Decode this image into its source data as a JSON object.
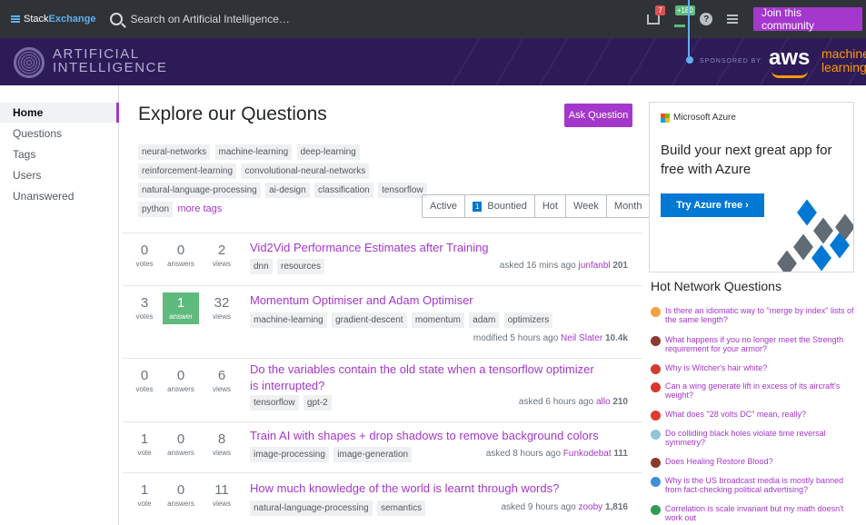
{
  "topbar": {
    "logo_stack": "Stack",
    "logo_exchange": "Exchange",
    "search_placeholder": "Search on Artificial Intelligence…",
    "inbox_count": "7",
    "rep_change": "+180",
    "help_glyph": "?",
    "join_label": "Join this community"
  },
  "banner": {
    "site_line1": "ARTIFICIAL",
    "site_line2": "INTELLIGENCE",
    "sponsored_by": "SPONSORED BY",
    "aws": "aws",
    "ml_line1": "machine",
    "ml_line2": "learning"
  },
  "sidebar": {
    "items": [
      {
        "label": "Home"
      },
      {
        "label": "Questions"
      },
      {
        "label": "Tags"
      },
      {
        "label": "Users"
      },
      {
        "label": "Unanswered"
      }
    ]
  },
  "main": {
    "title": "Explore our Questions",
    "ask_label": "Ask Question",
    "tags": [
      "neural-networks",
      "machine-learning",
      "deep-learning",
      "reinforcement-learning",
      "convolutional-neural-networks",
      "natural-language-processing",
      "ai-design",
      "classification",
      "tensorflow",
      "python"
    ],
    "more_tags": "more tags",
    "filters": {
      "active": "Active",
      "bountied_count": "1",
      "bountied": "Bountied",
      "hot": "Hot",
      "week": "Week",
      "month": "Month"
    },
    "questions": [
      {
        "votes": "0",
        "votes_lbl": "votes",
        "answers": "0",
        "answers_lbl": "answers",
        "views": "2",
        "views_lbl": "views",
        "title": "Vid2Vid Performance Estimates after Training",
        "tags": [
          "dnn",
          "resources"
        ],
        "action": "asked 16 mins ago",
        "user": "junfanbl",
        "rep": "201"
      },
      {
        "votes": "3",
        "votes_lbl": "votes",
        "answers": "1",
        "answers_lbl": "answer",
        "views": "32",
        "views_lbl": "views",
        "title": "Momentum Optimiser and Adam Optimiser",
        "tags": [
          "machine-learning",
          "gradient-descent",
          "momentum",
          "adam",
          "optimizers"
        ],
        "action": "modified 5 hours ago",
        "user": "Neil Slater",
        "rep": "10.4k"
      },
      {
        "votes": "0",
        "votes_lbl": "votes",
        "answers": "0",
        "answers_lbl": "answers",
        "views": "6",
        "views_lbl": "views",
        "title": "Do the variables contain the old state when a tensorflow optimizer is interrupted?",
        "tags": [
          "tensorflow",
          "gpt-2"
        ],
        "action": "asked 6 hours ago",
        "user": "allo",
        "rep": "210"
      },
      {
        "votes": "1",
        "votes_lbl": "vote",
        "answers": "0",
        "answers_lbl": "answers",
        "views": "8",
        "views_lbl": "views",
        "title": "Train AI with shapes + drop shadows to remove background colors",
        "tags": [
          "image-processing",
          "image-generation"
        ],
        "action": "asked 8 hours ago",
        "user": "Funkodebat",
        "rep": "111"
      },
      {
        "votes": "1",
        "votes_lbl": "vote",
        "answers": "0",
        "answers_lbl": "answers",
        "views": "11",
        "views_lbl": "views",
        "title": "How much knowledge of the world is learnt through words?",
        "tags": [
          "natural-language-processing",
          "semantics"
        ],
        "action": "asked 9 hours ago",
        "user": "zooby",
        "rep": "1,816"
      }
    ]
  },
  "ad": {
    "brand": "Microsoft Azure",
    "headline": "Build your next great app for free with Azure",
    "cta": "Try Azure free  ›"
  },
  "hnq": {
    "title": "Hot Network Questions",
    "items": [
      {
        "text": "Is there an idiomatic way to \"merge by index\" lists of the same length?",
        "color": "#f4a340"
      },
      {
        "text": "What happens if you no longer meet the Strength requirement for your armor?",
        "color": "#8b3a2b"
      },
      {
        "text": "Why is Witcher's hair white?",
        "color": "#d33b2c"
      },
      {
        "text": "Can a wing generate lift in excess of its aircraft's weight?",
        "color": "#d9362e"
      },
      {
        "text": "What does \"28 volts DC\" mean, really?",
        "color": "#e03a2f"
      },
      {
        "text": "Do colliding black holes violate time reversal symmetry?",
        "color": "#8fc6d8"
      },
      {
        "text": "Does Healing Restore Blood?",
        "color": "#8b3a2b"
      },
      {
        "text": "Why is the US broadcast media is mostly banned from fact-checking political advertising?",
        "color": "#3f8fd8"
      },
      {
        "text": "Correlation is scale invariant but my math doesn't work out",
        "color": "#2f9a5a"
      }
    ]
  }
}
